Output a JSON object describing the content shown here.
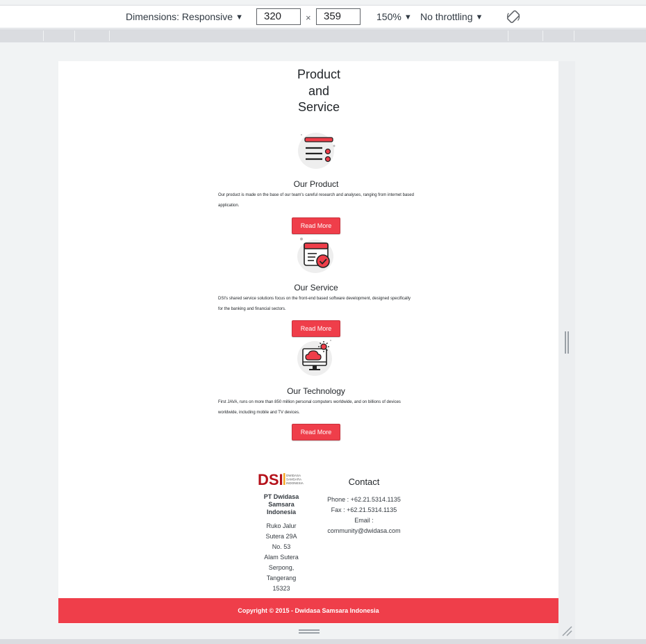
{
  "devtools": {
    "dimensions_label": "Dimensions: Responsive",
    "width_value": "320",
    "height_value": "359",
    "times_symbol": "×",
    "zoom": "150%",
    "throttling": "No throttling",
    "caret": "▼"
  },
  "page": {
    "heading_lines": [
      "Product",
      "and",
      "Service"
    ],
    "services": [
      {
        "icon": "document-list-icon",
        "title": "Our Product",
        "description": "Our product is made on the base of our team's careful research and analyses, ranging from internet based application.",
        "button": "Read More"
      },
      {
        "icon": "verified-document-icon",
        "title": "Our Service",
        "description": "DSI's shared service solutions focus on the front-end based software development, designed specifically for the banking and financial sectors.",
        "button": "Read More"
      },
      {
        "icon": "cloud-monitor-icon",
        "title": "Our Technology",
        "description": "First JAVA, runs on more than 850 million personal computers worldwide, and on billions of devices worldwide, including mobile and TV devices.",
        "button": "Read More"
      }
    ],
    "footer": {
      "logo_text": "DSI",
      "logo_sub": [
        "DWIDASA",
        "SAMSARA",
        "INDONESIA"
      ],
      "company_lines": [
        "PT Dwidasa",
        "Samsara",
        "Indonesia"
      ],
      "address_lines": [
        "Ruko Jalur",
        "Sutera 29A",
        "No. 53",
        "Alam Sutera",
        "Serpong,",
        "Tangerang",
        "15323"
      ],
      "contact_title": "Contact",
      "contact_lines": [
        "Phone : +62.21.5314.1135",
        "Fax : +62.21.5314.1135",
        "Email :",
        "community@dwidasa.com"
      ]
    },
    "copyright": "Copyright © 2015 - Dwidasa Samsara Indonesia"
  },
  "colors": {
    "accent": "#ef3e4a",
    "logo_red": "#b5121b",
    "logo_yellow": "#f5a623"
  }
}
